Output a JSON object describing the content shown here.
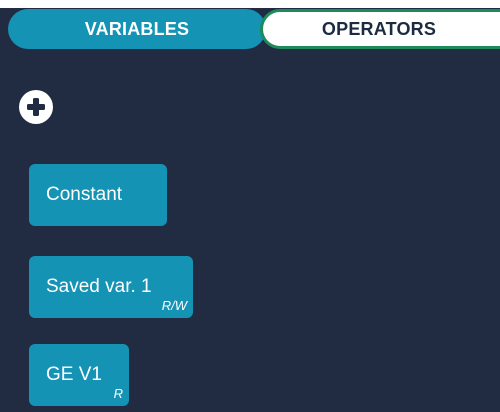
{
  "tabs": {
    "variables_label": "VARIABLES",
    "operators_label": "OPERATORS"
  },
  "add_button": {
    "icon": "plus-circle-icon"
  },
  "variables": [
    {
      "label": "Constant",
      "access": ""
    },
    {
      "label": "Saved var. 1",
      "access": "R/W"
    },
    {
      "label": "GE V1",
      "access": "R"
    }
  ],
  "colors": {
    "panel_background": "#212c43",
    "chip_background": "#1493b5",
    "operators_border": "#1f8a5a",
    "text_light": "#ffffff",
    "text_dark": "#1c2b40"
  }
}
